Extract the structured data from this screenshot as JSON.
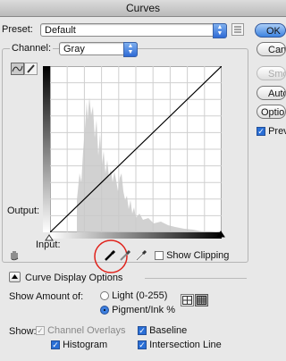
{
  "window": {
    "title": "Curves"
  },
  "preset": {
    "label": "Preset:",
    "value": "Default"
  },
  "channel": {
    "label": "Channel:",
    "value": "Gray"
  },
  "buttons": {
    "ok": "OK",
    "cancel": "Cancel",
    "smooth": "Smooth",
    "auto": "Auto",
    "options": "Options..."
  },
  "preview": {
    "label": "Preview",
    "checked": true
  },
  "graph": {
    "output_label": "Output:",
    "input_label": "Input:"
  },
  "show_clipping": {
    "label": "Show Clipping",
    "checked": false
  },
  "curve_display_options": {
    "label": "Curve Display Options"
  },
  "show_amount": {
    "label": "Show Amount of:",
    "options": [
      {
        "label": "Light  (0-255)",
        "selected": false
      },
      {
        "label": "Pigment/Ink %",
        "selected": true
      }
    ]
  },
  "show": {
    "label": "Show:",
    "items": [
      {
        "label": "Channel Overlays",
        "checked": true,
        "enabled": false
      },
      {
        "label": "Baseline",
        "checked": true,
        "enabled": true
      },
      {
        "label": "Histogram",
        "checked": true,
        "enabled": true
      },
      {
        "label": "Intersection Line",
        "checked": true,
        "enabled": true
      }
    ]
  },
  "colors": {
    "accent": "#2f6fd8",
    "highlight_circle": "#e0221b"
  }
}
